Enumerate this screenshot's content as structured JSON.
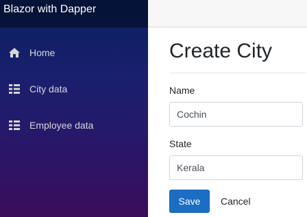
{
  "sidebar": {
    "brand": "Blazor with Dapper",
    "items": [
      {
        "label": "Home",
        "icon": "home-icon"
      },
      {
        "label": "City data",
        "icon": "list-icon"
      },
      {
        "label": "Employee data",
        "icon": "list-icon"
      }
    ]
  },
  "main": {
    "title": "Create City",
    "form": {
      "name_label": "Name",
      "name_value": "Cochin",
      "state_label": "State",
      "state_value": "Kerala"
    },
    "actions": {
      "save_label": "Save",
      "cancel_label": "Cancel"
    }
  },
  "colors": {
    "sidebar_top": "#08205c",
    "sidebar_bottom": "#3a0d5a",
    "primary_button": "#1b6ec2"
  }
}
